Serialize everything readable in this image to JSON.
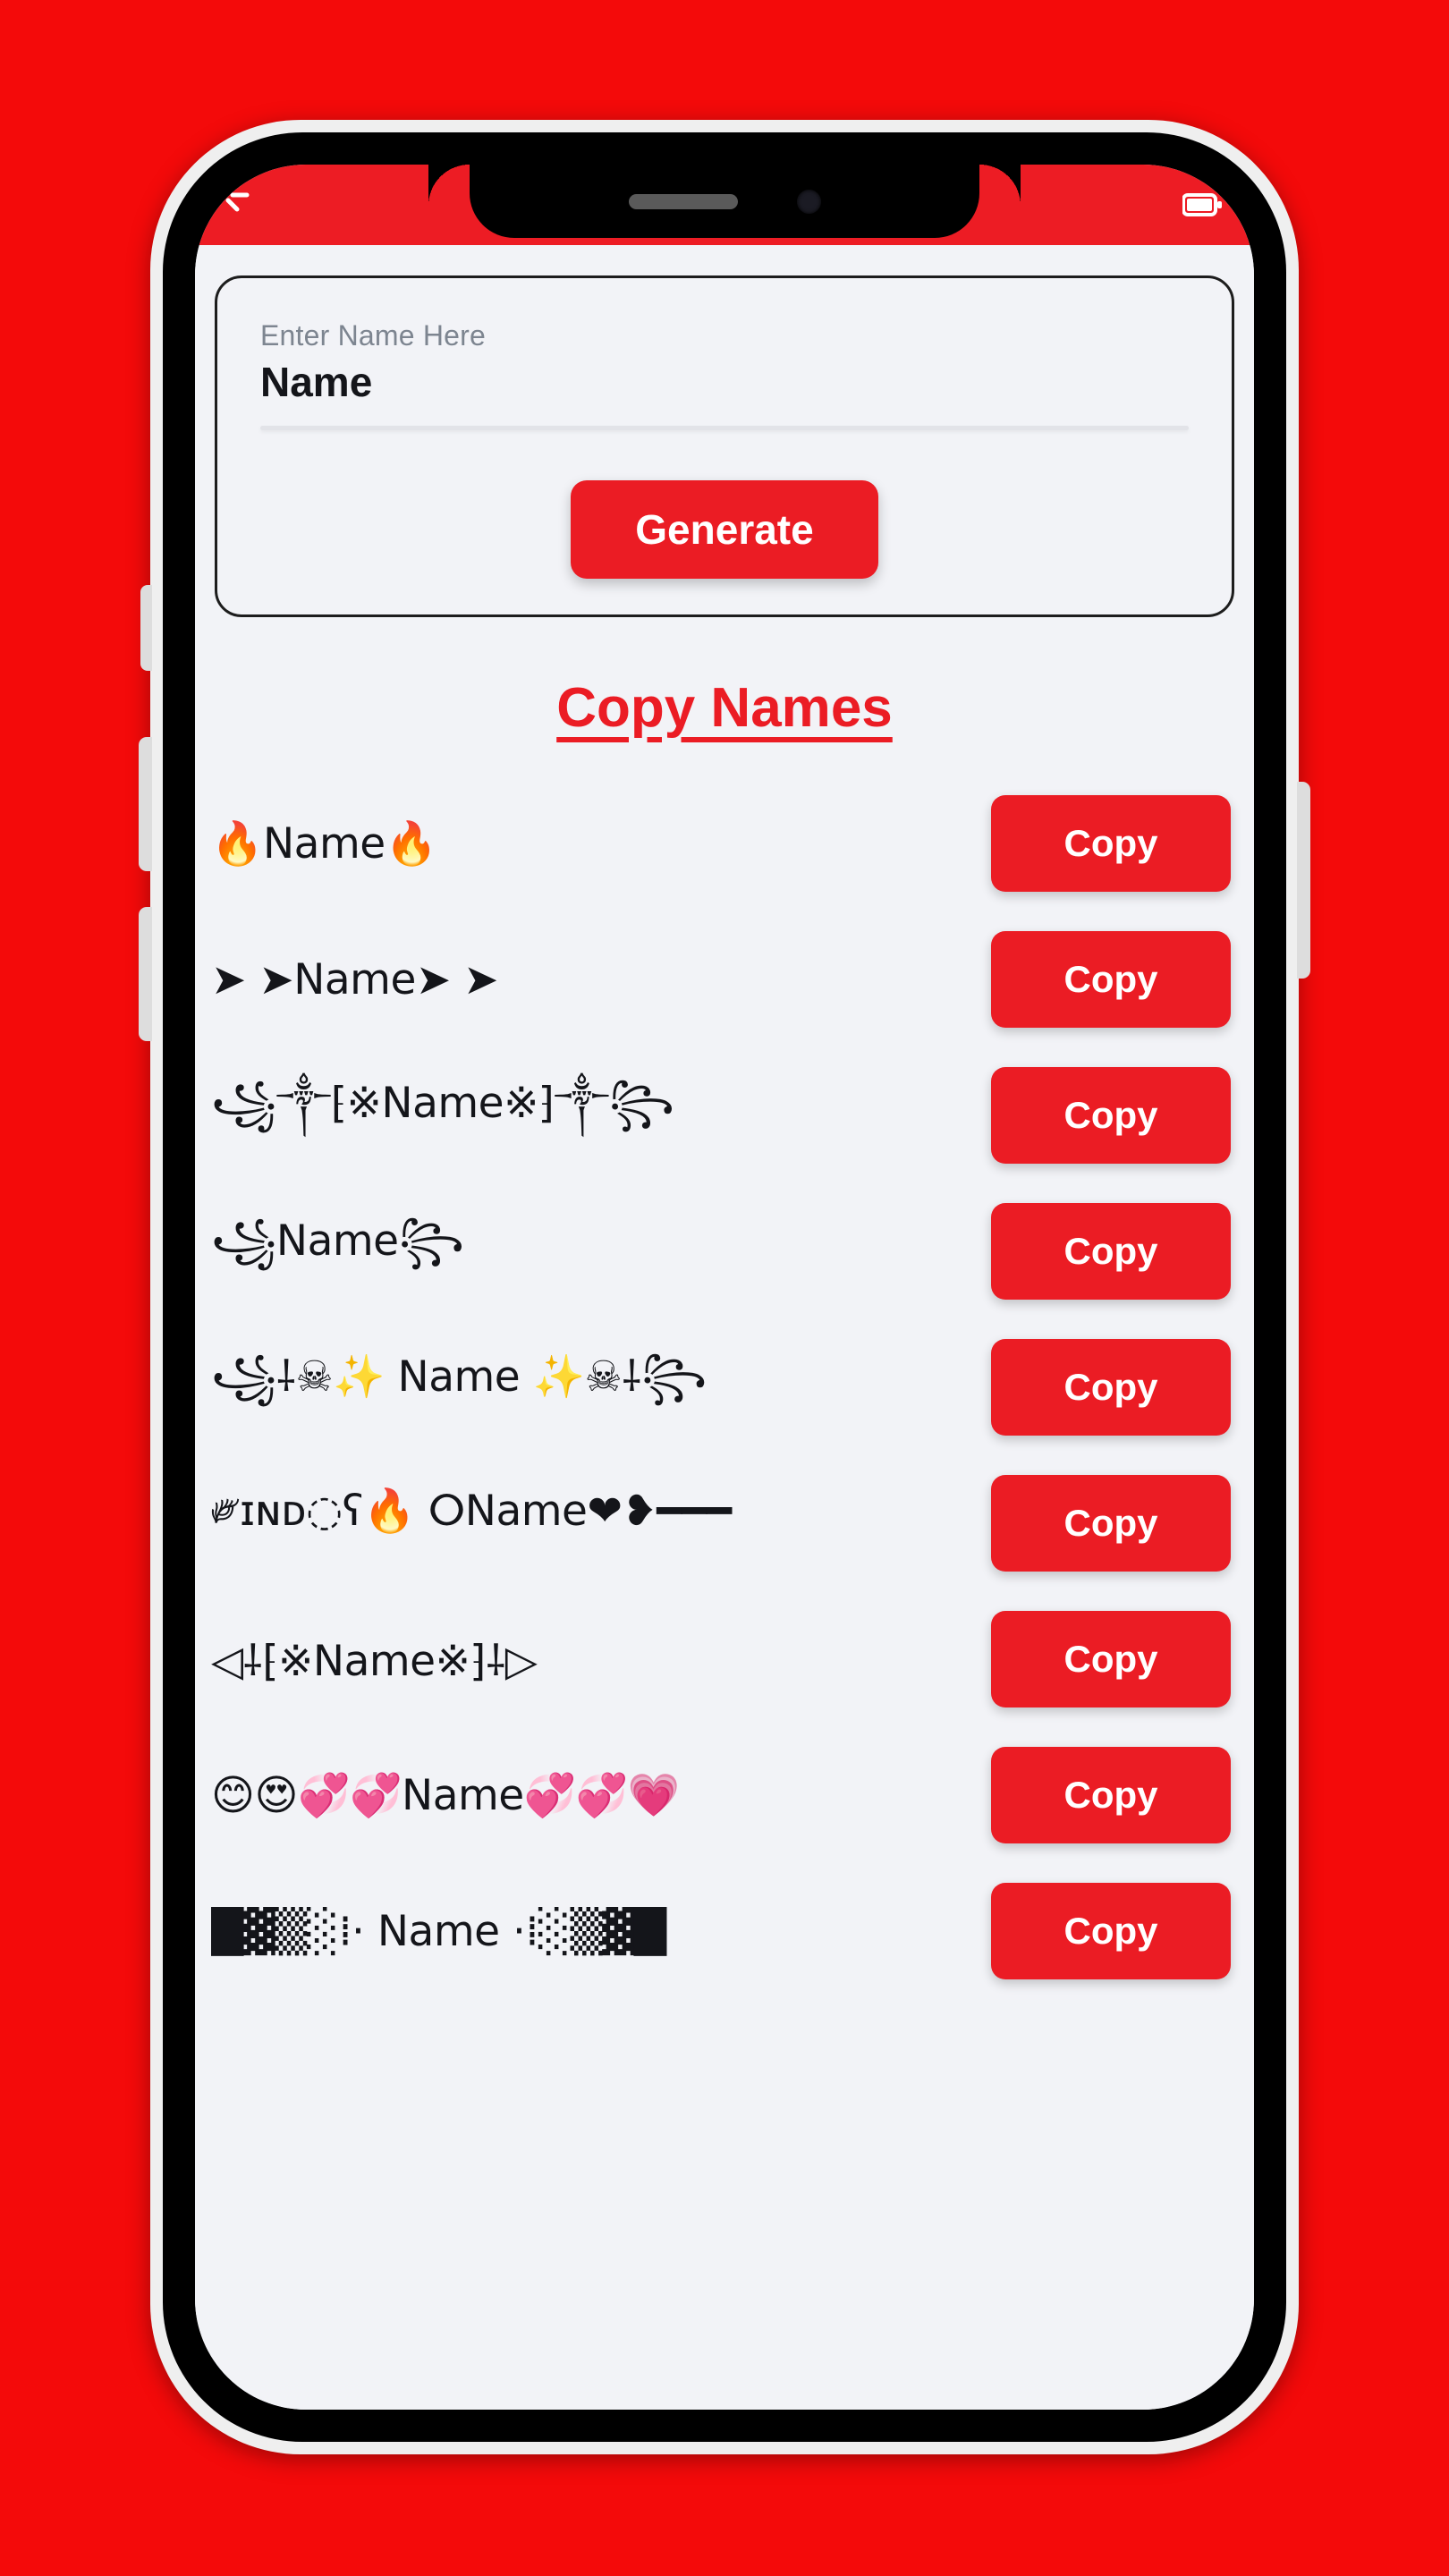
{
  "theme": {
    "background_red": "#F40A0A",
    "accent_red": "#EB1C24",
    "screen_bg": "#F2F3F7",
    "text_dark": "#14151A",
    "label_gray": "#7D8590"
  },
  "status_bar": {
    "left_icons": [
      "signal-icon"
    ],
    "right_icons": [
      "battery-icon"
    ]
  },
  "input_card": {
    "label": "Enter Name Here",
    "value": "Name",
    "placeholder": "Enter Name Here"
  },
  "generate_button": {
    "label": "Generate"
  },
  "heading": {
    "title": "Copy Names"
  },
  "names": [
    {
      "text": "🔥Name🔥",
      "copy_label": "Copy"
    },
    {
      "text": "➤ ➤Name➤ ➤",
      "copy_label": "Copy"
    },
    {
      "text": "꧁༒⁅※Name※⁆༒꧂",
      "copy_label": "Copy"
    },
    {
      "text": "꧁Name꧂",
      "copy_label": "Copy"
    },
    {
      "text": "꧁⸸☠✨ Name ✨☠⸸꧂",
      "copy_label": "Copy"
    },
    {
      "text": "༗ɪɴᴅ◌ʕ🔥 ⵔName❤❥━━━",
      "copy_label": "Copy"
    },
    {
      "text": "◁⸸⁅※Name※⁆⸸▷",
      "copy_label": "Copy"
    },
    {
      "text": "😊😍💞💞Name💞💞💗",
      "copy_label": "Copy"
    },
    {
      "text": "█▓▒░⁞· Name ·⁞░▒▓█",
      "copy_label": "Copy"
    }
  ]
}
